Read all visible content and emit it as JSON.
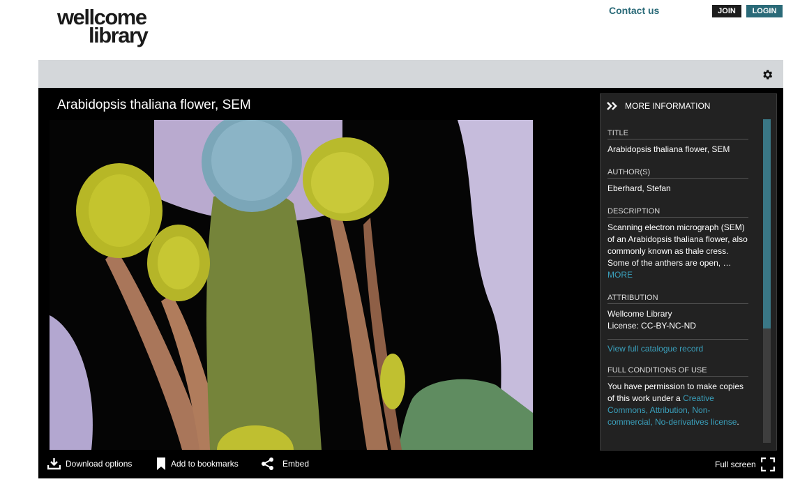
{
  "header": {
    "logo_line1": "wellcome",
    "logo_line2": "library",
    "contact": "Contact us",
    "join": "JOIN",
    "login": "LOGIN"
  },
  "toolbar": {
    "settings_icon": "gear-icon"
  },
  "viewer": {
    "title": "Arabidopsis thaliana flower, SEM",
    "bottom": {
      "download": "Download options",
      "bookmarks": "Add to bookmarks",
      "embed": "Embed",
      "fullscreen": "Full screen"
    }
  },
  "panel": {
    "heading": "MORE INFORMATION",
    "title_label": "TITLE",
    "title_value": "Arabidopsis thaliana flower, SEM",
    "author_label": "AUTHOR(S)",
    "author_value": "Eberhard, Stefan",
    "desc_label": "DESCRIPTION",
    "desc_value": "Scanning electron micrograph (SEM) of an Arabidopsis thaliana flower, also commonly known as thale cress. Some of the anthers are open,",
    "desc_ellipsis": "…",
    "desc_more": "MORE",
    "attribution_label": "ATTRIBUTION",
    "attribution_line1": "Wellcome Library",
    "attribution_line2": "License: CC-BY-NC-ND",
    "catalogue_link": "View full catalogue record",
    "conditions_label": "FULL CONDITIONS OF USE",
    "conditions_text": "You have permission to make copies of this work under a",
    "conditions_link": "Creative Commons, Attribution, Non-commercial, No-derivatives license",
    "conditions_end": "."
  },
  "colors": {
    "accent": "#2a6a78",
    "link": "#3aa0bc",
    "viewer_bg": "#000000",
    "panel_bg": "#222222"
  }
}
